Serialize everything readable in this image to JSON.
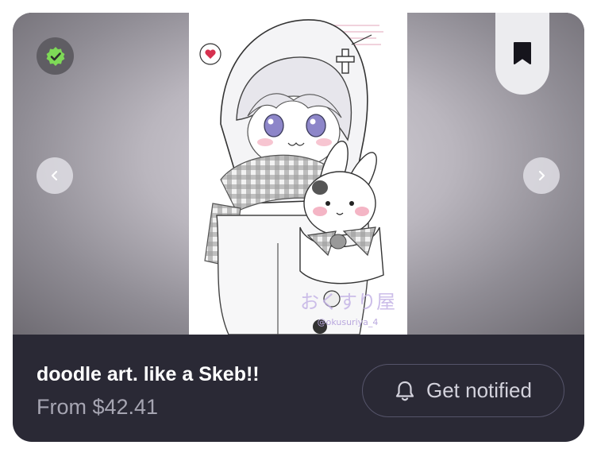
{
  "listing": {
    "title": "doodle art. like a Skeb!!",
    "price": "From $42.41",
    "artwork_caption": "おくすり屋",
    "artwork_handle": "@okusuriya_4"
  },
  "actions": {
    "notify_label": "Get notified"
  },
  "icons": {
    "verified": "check-badge-icon",
    "bookmark": "bookmark-icon",
    "prev": "chevron-left-icon",
    "next": "chevron-right-icon",
    "bell": "bell-icon"
  },
  "colors": {
    "card_background": "#2a2935",
    "verified_green": "#7ed957",
    "title_text": "#ffffff",
    "price_text": "#a6a5b2"
  }
}
